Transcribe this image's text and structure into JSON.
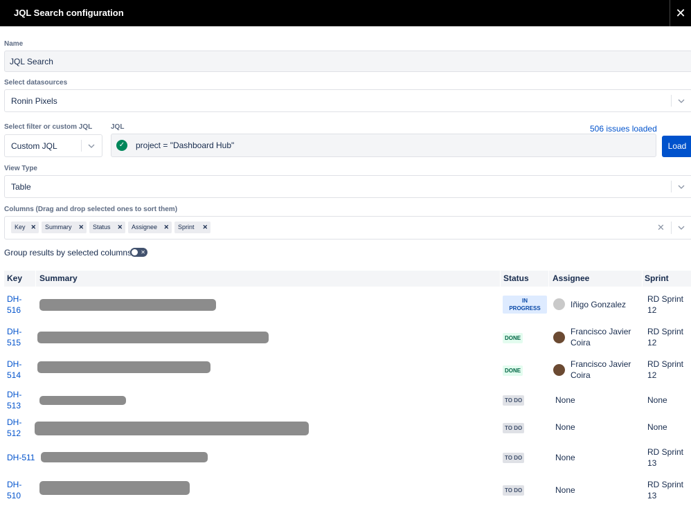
{
  "dialog": {
    "title": "JQL Search configuration",
    "close_glyph": "✕"
  },
  "form": {
    "name_label": "Name",
    "name_value": "JQL Search",
    "datasource_label": "Select datasources",
    "datasource_value": "Ronin Pixels",
    "filter_label": "Select filter or custom JQL",
    "filter_value": "Custom JQL",
    "jql_label": "JQL",
    "jql_value": "project = \"Dashboard Hub\"",
    "issues_loaded": "506 issues loaded",
    "load_label": "Load",
    "view_type_label": "View Type",
    "view_type_value": "Table",
    "columns_label": "Columns (Drag and drop selected ones to sort them)",
    "columns": [
      "Key",
      "Summary",
      "Status",
      "Assignee",
      "Sprint"
    ],
    "group_label": "Group results by selected columns",
    "group_toggle": false
  },
  "table": {
    "headers": {
      "key": "Key",
      "summary": "Summary",
      "status": "Status",
      "assignee": "Assignee",
      "sprint": "Sprint"
    },
    "rows": [
      {
        "key_a": "DH-",
        "key_b": "516",
        "status_a": "IN",
        "status_b": "PROGRESS",
        "assignee_a": "Iñigo Gonzalez",
        "assignee_b": "",
        "sprint_a": "RD Sprint",
        "sprint_b": "12"
      },
      {
        "key_a": "DH-",
        "key_b": "515",
        "status_a": "DONE",
        "status_b": "",
        "assignee_a": "Francisco Javier",
        "assignee_b": "Coira",
        "sprint_a": "RD Sprint",
        "sprint_b": "12"
      },
      {
        "key_a": "DH-",
        "key_b": "514",
        "status_a": "DONE",
        "status_b": "",
        "assignee_a": "Francisco Javier",
        "assignee_b": "Coira",
        "sprint_a": "RD Sprint",
        "sprint_b": "12"
      },
      {
        "key_a": "DH-",
        "key_b": "513",
        "status_a": "TO DO",
        "status_b": "",
        "assignee_a": "None",
        "assignee_b": "",
        "sprint_a": "None",
        "sprint_b": ""
      },
      {
        "key_a": "DH-",
        "key_b": "512",
        "status_a": "TO DO",
        "status_b": "",
        "assignee_a": "None",
        "assignee_b": "",
        "sprint_a": "None",
        "sprint_b": ""
      },
      {
        "key_a": "DH-511",
        "key_b": "",
        "status_a": "TO DO",
        "status_b": "",
        "assignee_a": "None",
        "assignee_b": "",
        "sprint_a": "RD Sprint",
        "sprint_b": "13"
      },
      {
        "key_a": "DH-",
        "key_b": "510",
        "status_a": "TO DO",
        "status_b": "",
        "assignee_a": "None",
        "assignee_b": "",
        "sprint_a": "RD Sprint",
        "sprint_b": "13"
      }
    ]
  },
  "icons": {
    "check": "check-icon",
    "chevron": "chevron-down-icon",
    "clear": "clear-icon"
  },
  "colors": {
    "accent": "#0052cc",
    "success": "#00875a",
    "header": "#000000"
  }
}
